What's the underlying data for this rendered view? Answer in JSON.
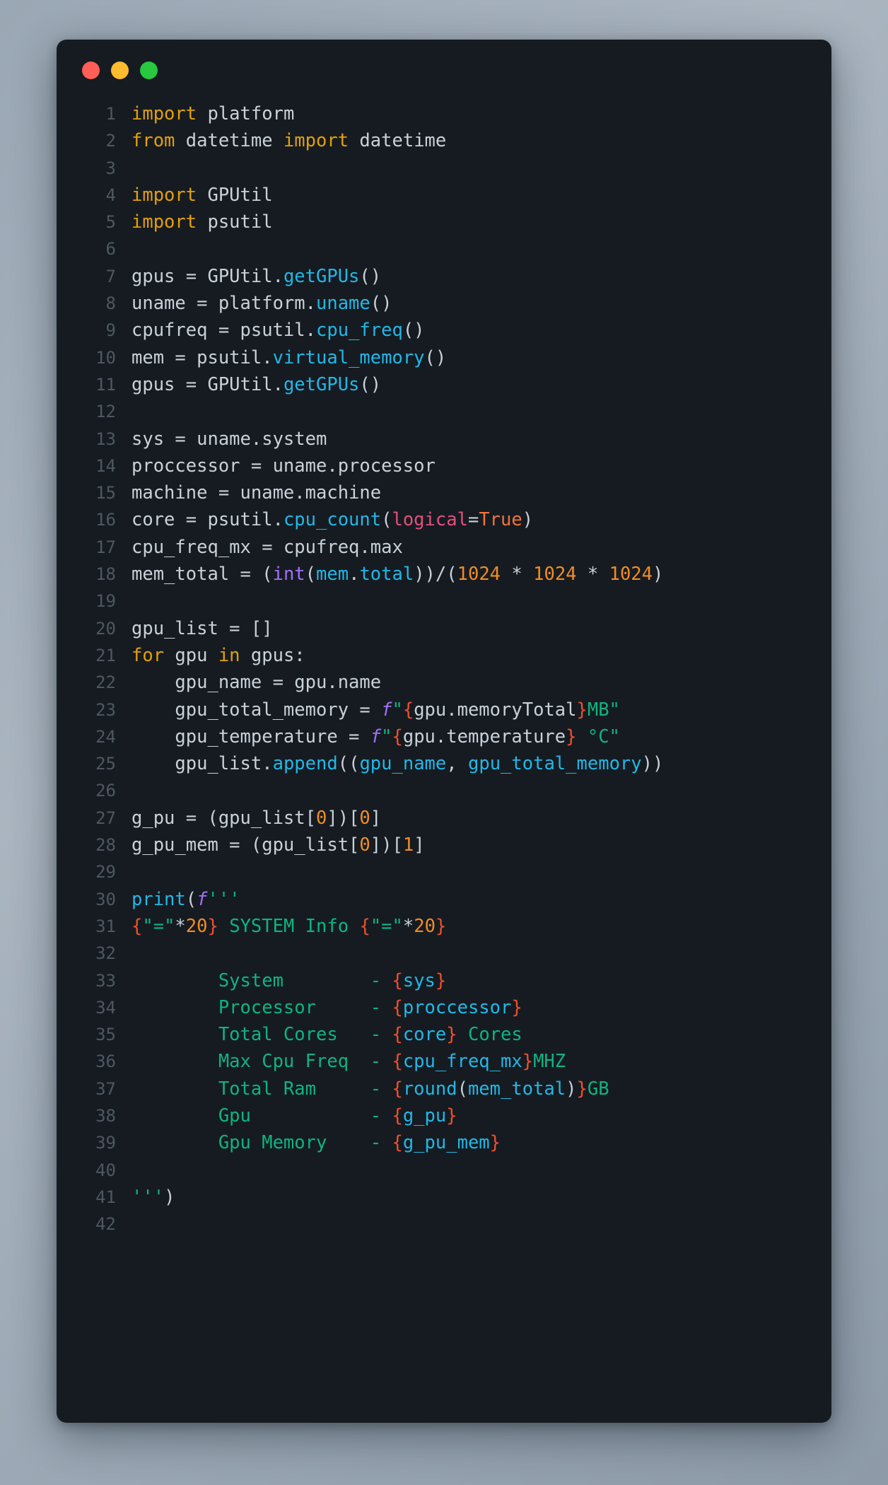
{
  "window": {
    "traffic_lights": [
      {
        "name": "close-button",
        "color": "#ff5f57"
      },
      {
        "name": "minimize-button",
        "color": "#febc2e"
      },
      {
        "name": "maximize-button",
        "color": "#28c840"
      }
    ],
    "background": "#161b22"
  },
  "editor": {
    "language": "python",
    "first_line": 1,
    "last_line": 42,
    "line_numbers": [
      "1",
      "2",
      "3",
      "4",
      "5",
      "6",
      "7",
      "8",
      "9",
      "10",
      "11",
      "12",
      "13",
      "14",
      "15",
      "16",
      "17",
      "18",
      "19",
      "20",
      "21",
      "22",
      "23",
      "24",
      "25",
      "26",
      "27",
      "28",
      "29",
      "30",
      "31",
      "32",
      "33",
      "34",
      "35",
      "36",
      "37",
      "38",
      "39",
      "40",
      "41",
      "42"
    ],
    "plain_text": [
      "import platform",
      "from datetime import datetime",
      "",
      "import GPUtil",
      "import psutil",
      "",
      "gpus = GPUtil.getGPUs()",
      "uname = platform.uname()",
      "cpufreq = psutil.cpu_freq()",
      "mem = psutil.virtual_memory()",
      "gpus = GPUtil.getGPUs()",
      "",
      "sys = uname.system",
      "proccessor = uname.processor",
      "machine = uname.machine",
      "core = psutil.cpu_count(logical=True)",
      "cpu_freq_mx = cpufreq.max",
      "mem_total = (int(mem.total))/(1024 * 1024 * 1024)",
      "",
      "gpu_list = []",
      "for gpu in gpus:",
      "    gpu_name = gpu.name",
      "    gpu_total_memory = f\"{gpu.memoryTotal}MB\"",
      "    gpu_temperature = f\"{gpu.temperature} °C\"",
      "    gpu_list.append((gpu_name, gpu_total_memory))",
      "",
      "g_pu = (gpu_list[0])[0]",
      "g_pu_mem = (gpu_list[0])[1]",
      "",
      "print(f'''",
      "{\"=\"*20} SYSTEM Info {\"=\"*20}",
      "",
      "        System        - {sys}",
      "        Processor     - {proccessor}",
      "        Total Cores   - {core} Cores",
      "        Max Cpu Freq  - {cpu_freq_mx}MHZ",
      "        Total Ram     - {round(mem_total)}GB",
      "        Gpu           - {g_pu}",
      "        Gpu Memory    - {g_pu_mem}",
      "",
      "''')",
      ""
    ],
    "lines": [
      {
        "n": "1",
        "tokens": [
          {
            "t": "import",
            "c": "kw"
          },
          {
            "t": " platform",
            "c": "pl"
          }
        ]
      },
      {
        "n": "2",
        "tokens": [
          {
            "t": "from",
            "c": "kw"
          },
          {
            "t": " datetime ",
            "c": "pl"
          },
          {
            "t": "import",
            "c": "kw"
          },
          {
            "t": " datetime",
            "c": "pl"
          }
        ]
      },
      {
        "n": "3",
        "tokens": []
      },
      {
        "n": "4",
        "tokens": [
          {
            "t": "import",
            "c": "kw"
          },
          {
            "t": " GPUtil",
            "c": "pl"
          }
        ]
      },
      {
        "n": "5",
        "tokens": [
          {
            "t": "import",
            "c": "kw"
          },
          {
            "t": " psutil",
            "c": "pl"
          }
        ]
      },
      {
        "n": "6",
        "tokens": []
      },
      {
        "n": "7",
        "tokens": [
          {
            "t": "gpus = GPUtil.",
            "c": "pl"
          },
          {
            "t": "getGPUs",
            "c": "fn"
          },
          {
            "t": "()",
            "c": "pl"
          }
        ]
      },
      {
        "n": "8",
        "tokens": [
          {
            "t": "uname = platform.",
            "c": "pl"
          },
          {
            "t": "uname",
            "c": "fn"
          },
          {
            "t": "()",
            "c": "pl"
          }
        ]
      },
      {
        "n": "9",
        "tokens": [
          {
            "t": "cpufreq = psutil.",
            "c": "pl"
          },
          {
            "t": "cpu_freq",
            "c": "fn"
          },
          {
            "t": "()",
            "c": "pl"
          }
        ]
      },
      {
        "n": "10",
        "tokens": [
          {
            "t": "mem = psutil.",
            "c": "pl"
          },
          {
            "t": "virtual_memory",
            "c": "fn"
          },
          {
            "t": "()",
            "c": "pl"
          }
        ]
      },
      {
        "n": "11",
        "tokens": [
          {
            "t": "gpus = GPUtil.",
            "c": "pl"
          },
          {
            "t": "getGPUs",
            "c": "fn"
          },
          {
            "t": "()",
            "c": "pl"
          }
        ]
      },
      {
        "n": "12",
        "tokens": []
      },
      {
        "n": "13",
        "tokens": [
          {
            "t": "sys = uname.system",
            "c": "pl"
          }
        ]
      },
      {
        "n": "14",
        "tokens": [
          {
            "t": "proccessor = uname.processor",
            "c": "pl"
          }
        ]
      },
      {
        "n": "15",
        "tokens": [
          {
            "t": "machine = uname.machine",
            "c": "pl"
          }
        ]
      },
      {
        "n": "16",
        "tokens": [
          {
            "t": "core = psutil.",
            "c": "pl"
          },
          {
            "t": "cpu_count",
            "c": "fn"
          },
          {
            "t": "(",
            "c": "pl"
          },
          {
            "t": "logical",
            "c": "param"
          },
          {
            "t": "=",
            "c": "pl"
          },
          {
            "t": "True",
            "c": "const"
          },
          {
            "t": ")",
            "c": "pl"
          }
        ]
      },
      {
        "n": "17",
        "tokens": [
          {
            "t": "cpu_freq_mx = cpufreq.max",
            "c": "pl"
          }
        ]
      },
      {
        "n": "18",
        "tokens": [
          {
            "t": "mem_total = (",
            "c": "pl"
          },
          {
            "t": "int",
            "c": "bi"
          },
          {
            "t": "(",
            "c": "pl"
          },
          {
            "t": "mem",
            "c": "fn"
          },
          {
            "t": ".",
            "c": "pl"
          },
          {
            "t": "total",
            "c": "fn"
          },
          {
            "t": "))/(",
            "c": "pl"
          },
          {
            "t": "1024",
            "c": "num"
          },
          {
            "t": " * ",
            "c": "pl"
          },
          {
            "t": "1024",
            "c": "num"
          },
          {
            "t": " * ",
            "c": "pl"
          },
          {
            "t": "1024",
            "c": "num"
          },
          {
            "t": ")",
            "c": "pl"
          }
        ]
      },
      {
        "n": "19",
        "tokens": []
      },
      {
        "n": "20",
        "tokens": [
          {
            "t": "gpu_list = []",
            "c": "pl"
          }
        ]
      },
      {
        "n": "21",
        "tokens": [
          {
            "t": "for",
            "c": "kw"
          },
          {
            "t": " gpu ",
            "c": "pl"
          },
          {
            "t": "in",
            "c": "kw"
          },
          {
            "t": " gpus:",
            "c": "pl"
          }
        ]
      },
      {
        "n": "22",
        "tokens": [
          {
            "t": "    gpu_name = gpu.name",
            "c": "pl"
          }
        ]
      },
      {
        "n": "23",
        "tokens": [
          {
            "t": "    gpu_total_memory = ",
            "c": "pl"
          },
          {
            "t": "f",
            "c": "fpfx"
          },
          {
            "t": "\"",
            "c": "str"
          },
          {
            "t": "{",
            "c": "brc"
          },
          {
            "t": "gpu.memoryTotal",
            "c": "pl"
          },
          {
            "t": "}",
            "c": "brc"
          },
          {
            "t": "MB\"",
            "c": "str"
          }
        ]
      },
      {
        "n": "24",
        "tokens": [
          {
            "t": "    gpu_temperature = ",
            "c": "pl"
          },
          {
            "t": "f",
            "c": "fpfx"
          },
          {
            "t": "\"",
            "c": "str"
          },
          {
            "t": "{",
            "c": "brc"
          },
          {
            "t": "gpu.temperature",
            "c": "pl"
          },
          {
            "t": "}",
            "c": "brc"
          },
          {
            "t": " °C\"",
            "c": "str"
          }
        ]
      },
      {
        "n": "25",
        "tokens": [
          {
            "t": "    gpu_list.",
            "c": "pl"
          },
          {
            "t": "append",
            "c": "fn"
          },
          {
            "t": "((",
            "c": "pl"
          },
          {
            "t": "gpu_name",
            "c": "var"
          },
          {
            "t": ", ",
            "c": "pl"
          },
          {
            "t": "gpu_total_memory",
            "c": "var"
          },
          {
            "t": "))",
            "c": "pl"
          }
        ]
      },
      {
        "n": "26",
        "tokens": []
      },
      {
        "n": "27",
        "tokens": [
          {
            "t": "g_pu = (gpu_list[",
            "c": "pl"
          },
          {
            "t": "0",
            "c": "num"
          },
          {
            "t": "])[",
            "c": "pl"
          },
          {
            "t": "0",
            "c": "num"
          },
          {
            "t": "]",
            "c": "pl"
          }
        ]
      },
      {
        "n": "28",
        "tokens": [
          {
            "t": "g_pu_mem = (gpu_list[",
            "c": "pl"
          },
          {
            "t": "0",
            "c": "num"
          },
          {
            "t": "])[",
            "c": "pl"
          },
          {
            "t": "1",
            "c": "num"
          },
          {
            "t": "]",
            "c": "pl"
          }
        ]
      },
      {
        "n": "29",
        "tokens": []
      },
      {
        "n": "30",
        "tokens": [
          {
            "t": "print",
            "c": "fn"
          },
          {
            "t": "(",
            "c": "pl"
          },
          {
            "t": "f",
            "c": "fpfx"
          },
          {
            "t": "'''",
            "c": "str"
          }
        ]
      },
      {
        "n": "31",
        "tokens": [
          {
            "t": "{",
            "c": "brc"
          },
          {
            "t": "\"=\"",
            "c": "str"
          },
          {
            "t": "*",
            "c": "pl"
          },
          {
            "t": "20",
            "c": "num"
          },
          {
            "t": "}",
            "c": "brc"
          },
          {
            "t": " SYSTEM Info ",
            "c": "str"
          },
          {
            "t": "{",
            "c": "brc"
          },
          {
            "t": "\"=\"",
            "c": "str"
          },
          {
            "t": "*",
            "c": "pl"
          },
          {
            "t": "20",
            "c": "num"
          },
          {
            "t": "}",
            "c": "brc"
          }
        ]
      },
      {
        "n": "32",
        "tokens": []
      },
      {
        "n": "33",
        "tokens": [
          {
            "t": "        System        - ",
            "c": "str"
          },
          {
            "t": "{",
            "c": "brc"
          },
          {
            "t": "sys",
            "c": "var"
          },
          {
            "t": "}",
            "c": "brc"
          }
        ]
      },
      {
        "n": "34",
        "tokens": [
          {
            "t": "        Processor     - ",
            "c": "str"
          },
          {
            "t": "{",
            "c": "brc"
          },
          {
            "t": "proccessor",
            "c": "var"
          },
          {
            "t": "}",
            "c": "brc"
          }
        ]
      },
      {
        "n": "35",
        "tokens": [
          {
            "t": "        Total Cores   - ",
            "c": "str"
          },
          {
            "t": "{",
            "c": "brc"
          },
          {
            "t": "core",
            "c": "var"
          },
          {
            "t": "}",
            "c": "brc"
          },
          {
            "t": " Cores",
            "c": "str"
          }
        ]
      },
      {
        "n": "36",
        "tokens": [
          {
            "t": "        Max Cpu Freq  - ",
            "c": "str"
          },
          {
            "t": "{",
            "c": "brc"
          },
          {
            "t": "cpu_freq_mx",
            "c": "var"
          },
          {
            "t": "}",
            "c": "brc"
          },
          {
            "t": "MHZ",
            "c": "str"
          }
        ]
      },
      {
        "n": "37",
        "tokens": [
          {
            "t": "        Total Ram     - ",
            "c": "str"
          },
          {
            "t": "{",
            "c": "brc"
          },
          {
            "t": "round",
            "c": "var"
          },
          {
            "t": "(",
            "c": "pl"
          },
          {
            "t": "mem_total",
            "c": "var"
          },
          {
            "t": ")",
            "c": "pl"
          },
          {
            "t": "}",
            "c": "brc"
          },
          {
            "t": "GB",
            "c": "str"
          }
        ]
      },
      {
        "n": "38",
        "tokens": [
          {
            "t": "        Gpu           - ",
            "c": "str"
          },
          {
            "t": "{",
            "c": "brc"
          },
          {
            "t": "g_pu",
            "c": "var"
          },
          {
            "t": "}",
            "c": "brc"
          }
        ]
      },
      {
        "n": "39",
        "tokens": [
          {
            "t": "        Gpu Memory    - ",
            "c": "str"
          },
          {
            "t": "{",
            "c": "brc"
          },
          {
            "t": "g_pu_mem",
            "c": "var"
          },
          {
            "t": "}",
            "c": "brc"
          }
        ]
      },
      {
        "n": "40",
        "tokens": []
      },
      {
        "n": "41",
        "tokens": [
          {
            "t": "'''",
            "c": "str"
          },
          {
            "t": ")",
            "c": "pl"
          }
        ]
      },
      {
        "n": "42",
        "tokens": []
      }
    ]
  },
  "theme": {
    "background": "#161b22",
    "keyword": "#e3a008",
    "function": "#22b8e6",
    "string": "#0fb47e",
    "number": "#f08d24",
    "builtin": "#a371f7",
    "parameter": "#e3507a",
    "constant": "#f0743a",
    "fstring_brace": "#f0502a",
    "plain_text": "#c9d1d9",
    "line_number": "#4d5862"
  }
}
